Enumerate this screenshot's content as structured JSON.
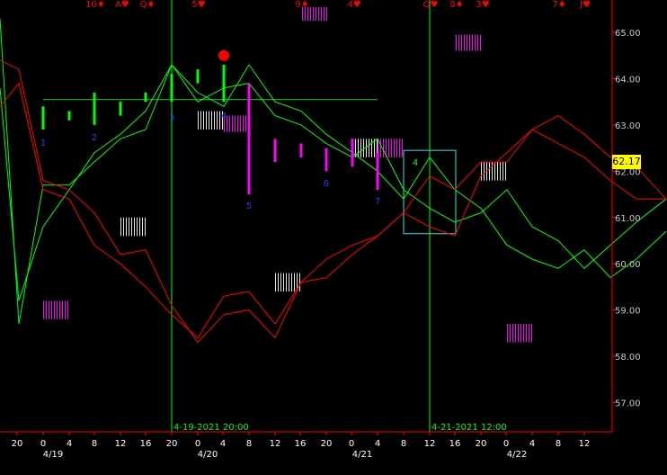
{
  "chart_data": {
    "type": "line",
    "y_axis": {
      "ylim": [
        56.4,
        65.7
      ],
      "ticks": [
        57.0,
        58.0,
        59.0,
        60.0,
        61.0,
        62.0,
        63.0,
        64.0,
        65.0
      ],
      "tick_labels": [
        "57.00",
        "58.00",
        "59.00",
        "60.00",
        "61.00",
        "62.00",
        "63.00",
        "64.00",
        "65.00"
      ],
      "side": "right"
    },
    "x_axis": {
      "hour_labels": [
        "20",
        "0",
        "4",
        "8",
        "12",
        "16",
        "20",
        "0",
        "4",
        "8",
        "12",
        "16",
        "20",
        "0",
        "4",
        "8",
        "12",
        "16",
        "20",
        "0",
        "4",
        "8",
        "12"
      ],
      "date_labels": [
        "4/19",
        "4/20",
        "4/21",
        "4/22"
      ]
    },
    "last_price": "62.17",
    "horizontal_line_price": 63.55,
    "vertical_markers": [
      {
        "label": "4-19-2021 20:00"
      },
      {
        "label": "4-21-2021 12:00"
      }
    ],
    "top_labels": [
      "10♦",
      "A♥",
      "Q♦",
      "5♥",
      "9♦",
      "4♥",
      "Q♥",
      "8♦",
      "3♥",
      "7♦",
      "J♥"
    ],
    "bar_labels": [
      "1",
      "2",
      "3",
      "4",
      "5",
      "6",
      "7"
    ],
    "green_annotation": "4",
    "colors": {
      "green": "#00ff00",
      "red": "#ff0000",
      "magenta": "#ff00ff",
      "cyan": "#40e0e0",
      "axis_text": "#ffffff",
      "price_labels": "#c8c8c8",
      "axis_line": "#ff0000",
      "bar_label": "#1e3cff"
    },
    "series": [
      {
        "values": [
          65.3,
          58.7,
          61.7,
          61.7,
          62.2,
          62.7,
          62.9,
          64.3,
          63.5,
          63.8,
          63.9,
          63.2,
          63.0,
          62.6,
          62.3,
          62.7,
          61.6,
          61.2,
          60.9,
          61.1,
          61.6,
          60.8,
          60.5,
          59.9,
          60.4,
          60.9,
          61.4
        ]
      },
      {
        "values": [
          63.8,
          59.2,
          60.8,
          61.6,
          62.4,
          62.8,
          63.3,
          64.3,
          63.7,
          63.4,
          64.3,
          63.5,
          63.3,
          62.8,
          62.4,
          62.0,
          61.4,
          62.3,
          61.6,
          61.2,
          60.4,
          60.1,
          59.9,
          60.3,
          59.7,
          60.1,
          60.7
        ]
      },
      {
        "values": [
          64.4,
          64.2,
          61.8,
          61.6,
          61.1,
          60.2,
          60.3,
          59.1,
          58.3,
          58.9,
          59.0,
          58.4,
          59.6,
          60.1,
          60.4,
          60.6,
          61.1,
          61.9,
          61.6,
          62.2,
          62.2,
          62.9,
          63.2,
          62.8,
          62.3,
          62.1,
          61.4
        ]
      },
      {
        "values": [
          63.4,
          63.9,
          61.6,
          61.4,
          60.4,
          60.0,
          59.5,
          58.9,
          58.4,
          59.3,
          59.4,
          58.7,
          59.6,
          59.7,
          60.2,
          60.6,
          61.1,
          60.8,
          60.6,
          61.9,
          62.4,
          62.9,
          62.6,
          62.3,
          61.8,
          61.4,
          61.4
        ]
      }
    ],
    "price_bars": [
      {
        "high": 63.4,
        "low": 62.9,
        "color": "green"
      },
      {
        "high": 63.3,
        "low": 63.1,
        "color": "green"
      },
      {
        "high": 63.7,
        "low": 63.0,
        "color": "green"
      },
      {
        "high": 63.5,
        "low": 63.2,
        "color": "green"
      },
      {
        "high": 63.7,
        "low": 63.5,
        "color": "green"
      },
      {
        "high": 64.1,
        "low": 63.5,
        "color": "green"
      },
      {
        "high": 64.2,
        "low": 63.9,
        "color": "green"
      },
      {
        "high": 64.3,
        "low": 63.5,
        "color": "green"
      },
      {
        "high": 63.9,
        "low": 61.5,
        "color": "magenta"
      },
      {
        "high": 62.7,
        "low": 62.2,
        "color": "magenta"
      },
      {
        "high": 62.6,
        "low": 62.3,
        "color": "magenta"
      },
      {
        "high": 62.5,
        "low": 62.0,
        "color": "magenta"
      },
      {
        "high": 62.7,
        "low": 62.1,
        "color": "magenta"
      },
      {
        "high": 62.4,
        "low": 61.6,
        "color": "magenta"
      }
    ],
    "red_dot_price": 64.5,
    "profile_blocks": [
      {
        "price_top": 65.55,
        "price_bottom": 65.25,
        "color": "magenta"
      },
      {
        "price_top": 64.95,
        "price_bottom": 64.6,
        "color": "magenta"
      },
      {
        "price_top": 63.2,
        "price_bottom": 62.85,
        "color": "magenta"
      },
      {
        "price_top": 62.7,
        "price_bottom": 62.3,
        "color": "magenta"
      },
      {
        "price_top": 59.2,
        "price_bottom": 58.8,
        "color": "magenta"
      },
      {
        "price_top": 58.7,
        "price_bottom": 58.3,
        "color": "magenta"
      },
      {
        "price_top": 63.3,
        "price_bottom": 62.9,
        "color": "white"
      },
      {
        "price_top": 62.7,
        "price_bottom": 62.3,
        "color": "white"
      },
      {
        "price_top": 62.2,
        "price_bottom": 61.8,
        "color": "white"
      },
      {
        "price_top": 61.0,
        "price_bottom": 60.6,
        "color": "white"
      },
      {
        "price_top": 59.8,
        "price_bottom": 59.4,
        "color": "white"
      }
    ],
    "highlight_box": {
      "price_top": 62.45,
      "price_bottom": 60.65
    }
  }
}
